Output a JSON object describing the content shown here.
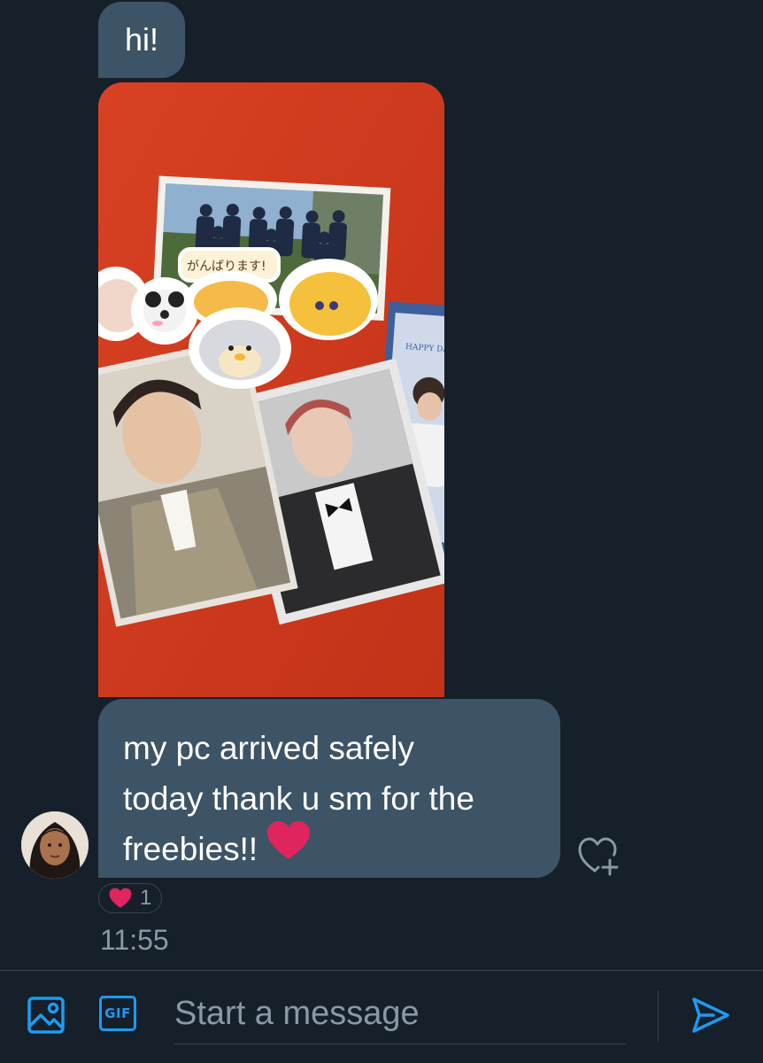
{
  "messages": [
    {
      "type": "text",
      "text": "hi!"
    },
    {
      "type": "image",
      "photo_text": {
        "sticker_text": "がんばります!",
        "card_text": "HAPPY DA"
      }
    },
    {
      "type": "text",
      "lines": [
        "my pc arrived safely",
        "today thank u sm for the",
        "freebies!!"
      ],
      "emoji": "red-heart"
    }
  ],
  "reactions": [
    {
      "emoji": "red-heart",
      "count": "1"
    }
  ],
  "timestamp": "11:55",
  "composer": {
    "placeholder": "Start a message",
    "image_icon": "image-icon",
    "gif_label": "GIF",
    "send_icon": "send-icon"
  },
  "colors": {
    "background": "#15202b",
    "bubble": "#3d5466",
    "accent": "#1d9bf0",
    "muted": "#8b98a5",
    "heart": "#e0245e"
  }
}
